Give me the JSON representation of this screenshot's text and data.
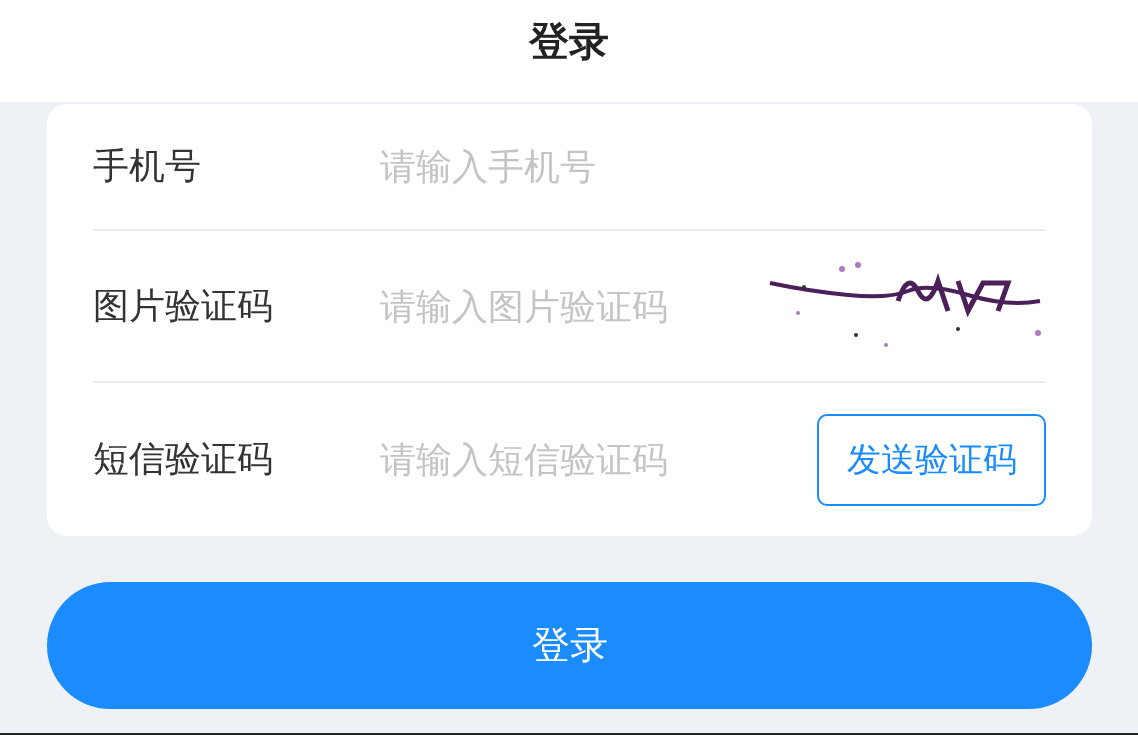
{
  "header": {
    "title": "登录"
  },
  "fields": [
    {
      "kind": "phone",
      "label": "手机号",
      "placeholder": "请输入手机号"
    },
    {
      "kind": "captcha",
      "label": "图片验证码",
      "placeholder": "请输入图片验证码"
    },
    {
      "kind": "sms",
      "label": "短信验证码",
      "placeholder": "请输入短信验证码",
      "action": "发送验证码"
    }
  ],
  "submit": {
    "label": "登录"
  }
}
